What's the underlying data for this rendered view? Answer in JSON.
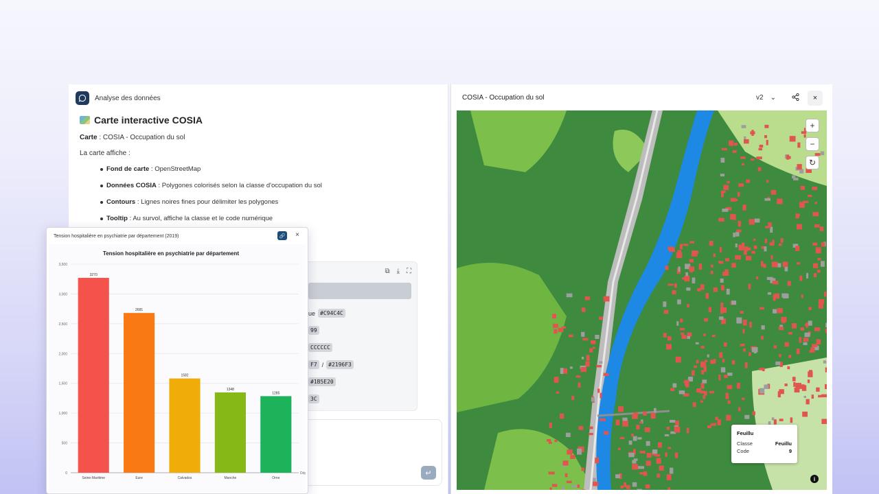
{
  "chat": {
    "header_title": "Analyse des données",
    "heading": "Carte interactive COSIA",
    "carte_label": "Carte",
    "carte_value": " : COSIA - Occupation du sol",
    "intro": "La carte affiche :",
    "features": [
      {
        "label": "Fond de carte",
        "text": " : OpenStreetMap"
      },
      {
        "label": "Données COSIA",
        "text": " : Polygones colorisés selon la classe d'occupation du sol"
      },
      {
        "label": "Contours",
        "text": " : Lignes noires fines pour délimiter les polygones"
      },
      {
        "label": "Tooltip",
        "text": " : Au survol, affiche la classe et le code numérique"
      }
    ]
  },
  "code_block": {
    "lines": [
      {
        "prefix": "ue",
        "chips": [
          "#C94C4C"
        ]
      },
      {
        "prefix": "",
        "chips": [
          "99"
        ]
      },
      {
        "prefix": "",
        "chips": [
          "CCCCCC"
        ]
      },
      {
        "prefix": "",
        "chips": [
          "F7",
          "/",
          "#2196F3"
        ]
      },
      {
        "prefix": "",
        "chips": [
          "#1B5E20"
        ]
      },
      {
        "prefix": "",
        "chips": [
          "3C"
        ]
      }
    ]
  },
  "chart_window": {
    "title": "Tension hospitalière en psychiatrie par département (2019)"
  },
  "chart_data": {
    "type": "bar",
    "title": "Tension hospitalière en psychiatrie par département",
    "categories": [
      "Seine-Maritime",
      "Eure",
      "Calvados",
      "Manche",
      "Orne"
    ],
    "values": [
      3270,
      2681,
      1582,
      1348,
      1285
    ],
    "colors": [
      "#f4524a",
      "#f97a14",
      "#f0ac08",
      "#86b817",
      "#1db35a"
    ],
    "ylim": [
      0,
      3500
    ],
    "yticks": [
      "0",
      "500",
      "1,000",
      "1,500",
      "2,000",
      "2,500",
      "3,000",
      "3,500"
    ],
    "xlabel": "Dép",
    "grid": true
  },
  "map": {
    "title": "COSIA - Occupation du sol",
    "version": "v2",
    "tooltip": {
      "title": "Feuillu",
      "rows": [
        {
          "key": "Classe",
          "value": "Feuillu"
        },
        {
          "key": "Code",
          "value": "9"
        }
      ]
    },
    "colors": {
      "forest": "#2f7d32",
      "meadow": "#7cbf4a",
      "water": "#1e88e5",
      "building": "#e0564e",
      "road": "#9e9e9e",
      "light": "#c6e2a8"
    }
  },
  "icons": {
    "zoom_in": "+",
    "zoom_out": "−",
    "reset": "↻",
    "close": "×",
    "info": "i",
    "send": "↵"
  }
}
